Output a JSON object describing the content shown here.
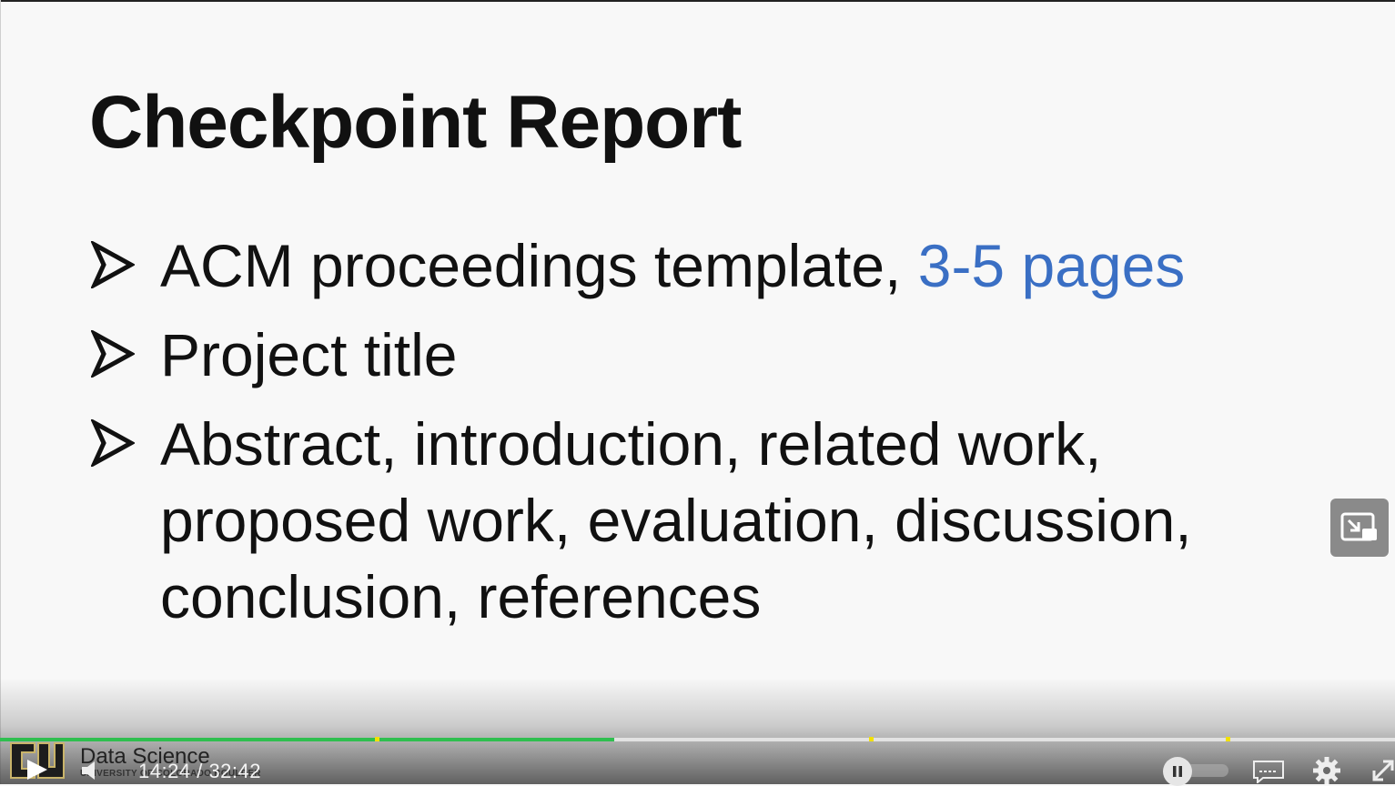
{
  "slide": {
    "title": "Checkpoint Report",
    "bullets": [
      {
        "text": "ACM proceedings template, ",
        "highlight": "3-5 pages"
      },
      {
        "text": "Project title",
        "highlight": ""
      },
      {
        "text": "Abstract, introduction, related work, proposed work, evaluation, discussion, conclusion, references",
        "highlight": ""
      }
    ],
    "accent_color": "#3a6fc4"
  },
  "player": {
    "current_time": "14:24",
    "separator": "/",
    "duration": "32:42",
    "played_fraction": 0.44,
    "buffered_fraction": 1.0,
    "chapter_marker_fractions": [
      0.27,
      0.624,
      0.88
    ],
    "progress_color": "#2fbf4f",
    "marker_color": "#f2e100",
    "logo": {
      "name": "Data Science",
      "subtitle": "UNIVERSITY OF COLORADO BOULDER"
    },
    "icons": {
      "play": "play-icon",
      "volume": "volume-icon",
      "speed": "pause-icon",
      "captions": "captions-icon",
      "settings": "gear-icon",
      "fullscreen": "fullscreen-icon",
      "pip": "picture-in-picture-icon"
    }
  }
}
